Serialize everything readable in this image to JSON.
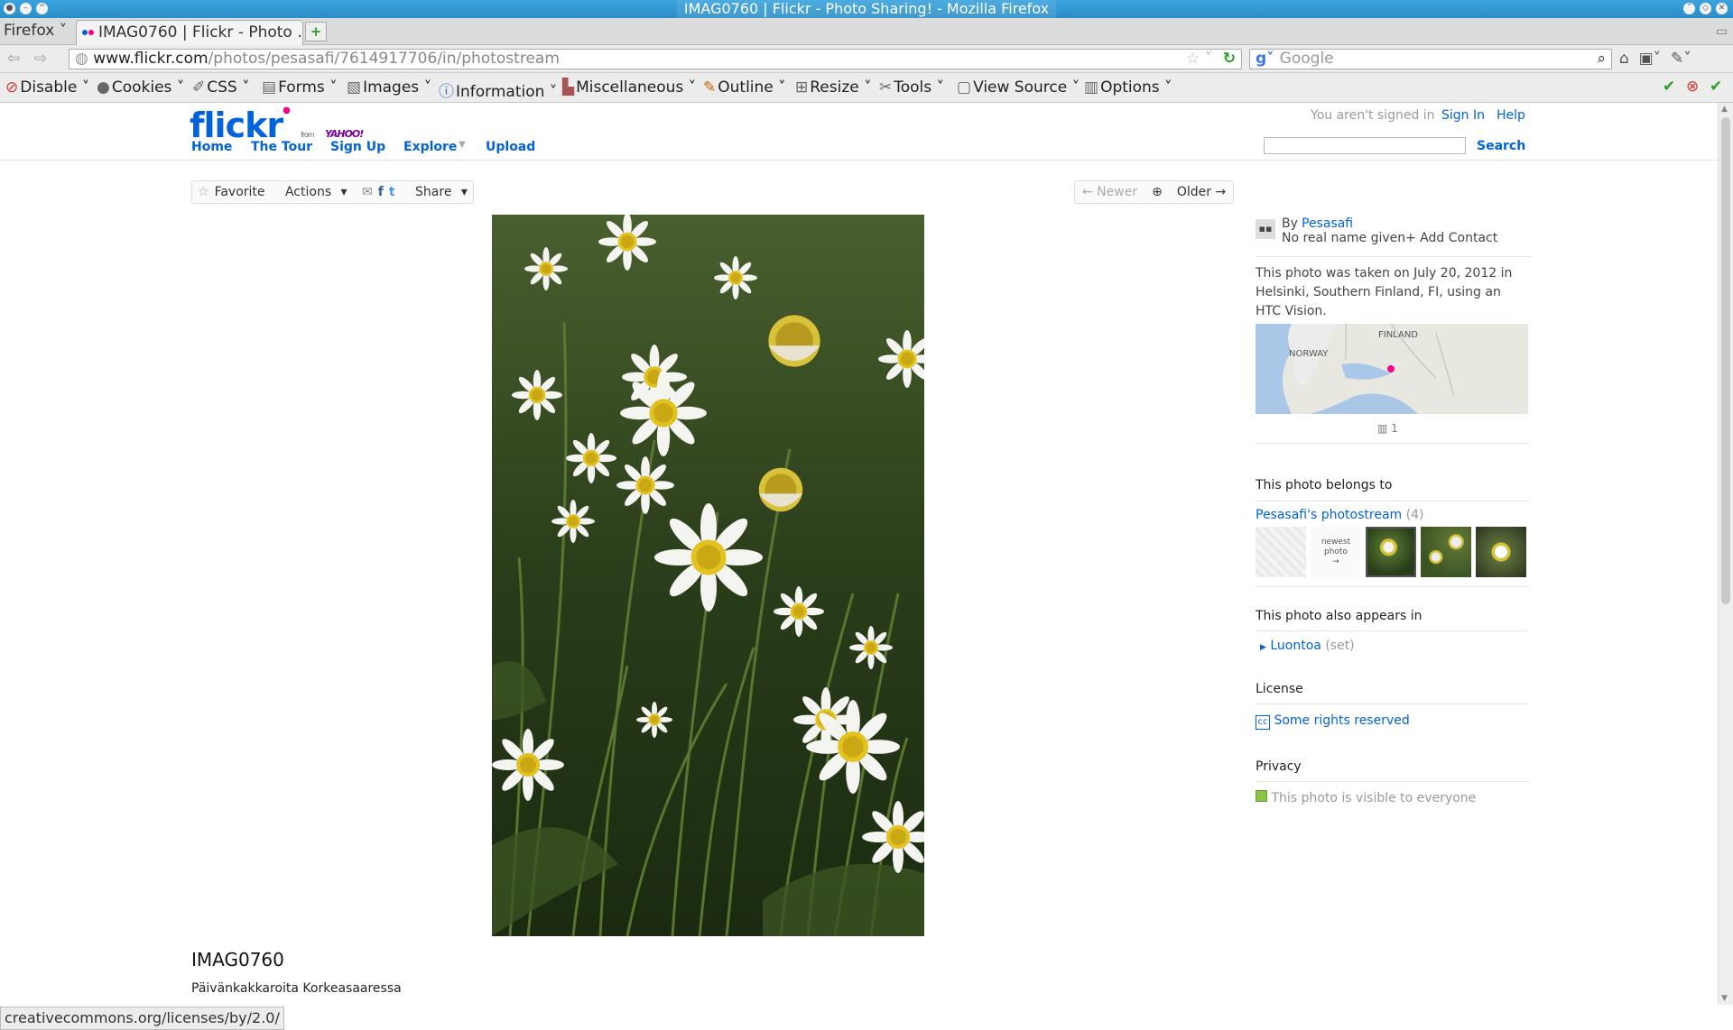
{
  "window": {
    "title": "IMAG0760 | Flickr - Photo Sharing! - Mozilla Firefox"
  },
  "browser": {
    "menu_label": "Firefox",
    "tab_title": "IMAG0760 | Flickr - Photo ...",
    "url_domain": "www.flickr.com",
    "url_path": "/photos/pesasafi/7614917706/in/photostream",
    "search_engine": "Google",
    "search_placeholder": "Google"
  },
  "devtoolbar": {
    "items": [
      "Disable",
      "Cookies",
      "CSS",
      "Forms",
      "Images",
      "Information",
      "Miscellaneous",
      "Outline",
      "Resize",
      "Tools",
      "View Source",
      "Options"
    ]
  },
  "flickr": {
    "logo_text": "flickr",
    "logo_from": "from",
    "logo_yahoo": "YAHOO!",
    "nav": [
      "Home",
      "The Tour",
      "Sign Up",
      "Explore",
      "Upload"
    ],
    "not_signed_in": "You aren't signed in",
    "sign_in": "Sign In",
    "help": "Help",
    "search_button": "Search"
  },
  "actions": {
    "favorite": "Favorite",
    "actions": "Actions",
    "share": "Share",
    "newer": "← Newer",
    "older": "Older →"
  },
  "photo": {
    "title": "IMAG0760",
    "description": "Päivänkakkaroita Korkeasaaressa"
  },
  "sidebar": {
    "by_prefix": "By",
    "owner": "Pesasafi",
    "real_name": "No real name given",
    "add_contact": "+ Add Contact",
    "taken_text": "This photo was taken on July 20, 2012 in Helsinki, Southern Finland, FI, using an HTC Vision.",
    "map_labels": [
      "FINLAND",
      "NORWAY"
    ],
    "views": "1",
    "belongs_heading": "This photo belongs to",
    "photostream": "Pesasafi's photostream",
    "photostream_count": "(4)",
    "newest_label": "newest photo",
    "appears_heading": "This photo also appears in",
    "set_name": "Luontoa",
    "set_type": "(set)",
    "license_heading": "License",
    "license_text": "Some rights reserved",
    "privacy_heading": "Privacy",
    "privacy_text": "This photo is visible to everyone"
  },
  "statusbar": {
    "text": "creativecommons.org/licenses/by/2.0/"
  }
}
